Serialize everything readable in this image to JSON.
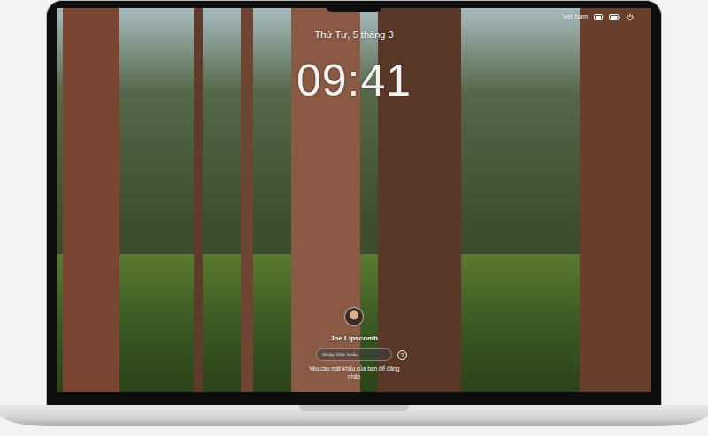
{
  "menu_bar": {
    "input_source": "Việt Nam"
  },
  "lock_screen": {
    "date": "Thứ Tư, 5 tháng 3",
    "time": "09:41",
    "user": {
      "name": "Joe Lipscomb"
    },
    "password": {
      "placeholder": "Nhập Mật khẩu"
    },
    "help": "?",
    "hint": "Yêu cầu mật khẩu của bạn để đăng nhập"
  }
}
